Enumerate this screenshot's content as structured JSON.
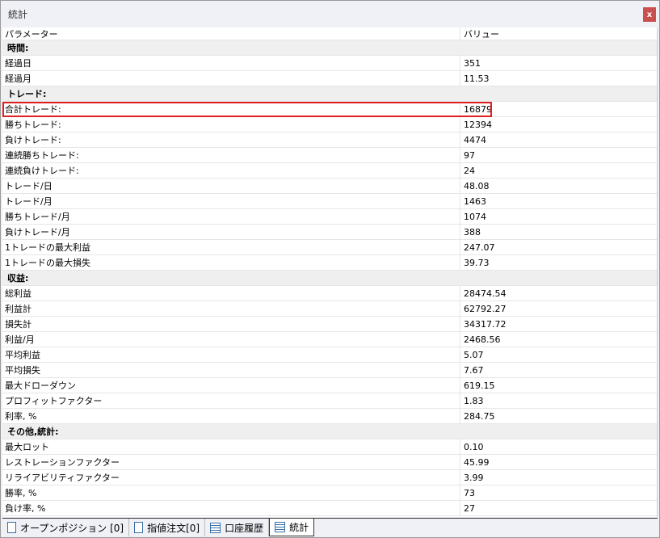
{
  "window": {
    "title": "統計",
    "close_label": "x"
  },
  "columns": {
    "param": "パラメーター",
    "value": "バリュー"
  },
  "sections": [
    {
      "title": "時間:",
      "rows": [
        {
          "label": "経過日",
          "value": "351"
        },
        {
          "label": "経過月",
          "value": "11.53"
        }
      ]
    },
    {
      "title": "トレード:",
      "rows": [
        {
          "label": "合計トレード:",
          "value": "16879",
          "highlighted": true
        },
        {
          "label": "勝ちトレード:",
          "value": "12394"
        },
        {
          "label": "負けトレード:",
          "value": "4474"
        },
        {
          "label": "連続勝ちトレード:",
          "value": "97"
        },
        {
          "label": "連続負けトレード:",
          "value": "24"
        },
        {
          "label": "トレード/日",
          "value": "48.08"
        },
        {
          "label": "トレード/月",
          "value": "1463"
        },
        {
          "label": "勝ちトレード/月",
          "value": "1074"
        },
        {
          "label": "負けトレード/月",
          "value": "388"
        },
        {
          "label": "1トレードの最大利益",
          "value": "247.07"
        },
        {
          "label": "1トレードの最大損失",
          "value": "39.73"
        }
      ]
    },
    {
      "title": "収益:",
      "rows": [
        {
          "label": "総利益",
          "value": "28474.54"
        },
        {
          "label": "利益計",
          "value": "62792.27"
        },
        {
          "label": "損失計",
          "value": "34317.72"
        },
        {
          "label": "利益/月",
          "value": "2468.56"
        },
        {
          "label": "平均利益",
          "value": "5.07"
        },
        {
          "label": "平均損失",
          "value": "7.67"
        },
        {
          "label": "最大ドローダウン",
          "value": "619.15"
        },
        {
          "label": "プロフィットファクター",
          "value": "1.83"
        },
        {
          "label": "利率, %",
          "value": "284.75"
        }
      ]
    },
    {
      "title": "その他,統計:",
      "rows": [
        {
          "label": "最大ロット",
          "value": "0.10"
        },
        {
          "label": "レストレーションファクター",
          "value": "45.99"
        },
        {
          "label": "リライアビリティファクター",
          "value": "3.99"
        },
        {
          "label": "勝率, %",
          "value": "73"
        },
        {
          "label": "負け率, %",
          "value": "27"
        }
      ]
    }
  ],
  "tabs": [
    {
      "label": "オープンポジション [0]",
      "icon": "document-icon",
      "active": false
    },
    {
      "label": "指値注文[0]",
      "icon": "pending-order-icon",
      "active": false
    },
    {
      "label": "口座履歴",
      "icon": "table-icon",
      "active": false
    },
    {
      "label": "統計",
      "icon": "table-icon",
      "active": true
    }
  ]
}
